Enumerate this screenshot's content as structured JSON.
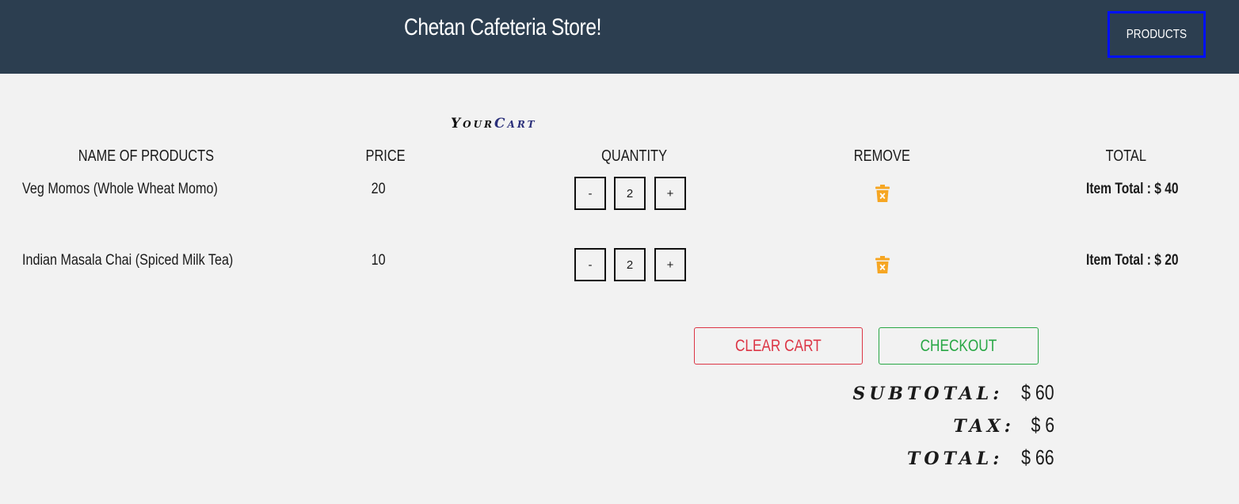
{
  "header": {
    "title": "Chetan Cafeteria Store!",
    "products_label": "PRODUCTS"
  },
  "cart": {
    "heading_word1": "Your",
    "heading_word2": "Cart",
    "columns": [
      "NAME OF PRODUCTS",
      "PRICE",
      "QUANTITY",
      "REMOVE",
      "TOTAL"
    ],
    "items": [
      {
        "name": "Veg Momos (Whole Wheat Momo)",
        "price": "20",
        "decrement": "-",
        "quantity": "2",
        "increment": "+",
        "item_total": "Item Total : $ 40"
      },
      {
        "name": "Indian Masala Chai (Spiced Milk Tea)",
        "price": "10",
        "decrement": "-",
        "quantity": "2",
        "increment": "+",
        "item_total": "Item Total : $ 20"
      }
    ],
    "remove_icon": "trash-icon",
    "remove_icon_color": "#f6a623"
  },
  "actions": {
    "clear_label": "CLEAR CART",
    "checkout_label": "CHECKOUT"
  },
  "summary": {
    "subtotal_label": "Subtotal:",
    "subtotal_value": "$ 60",
    "tax_label": "Tax:",
    "tax_value": "$ 6",
    "total_label": "Total:",
    "total_value": "$ 66"
  },
  "colors": {
    "header_bg": "#2c3e50",
    "products_border": "#0010ff",
    "clear": "#dc3545",
    "checkout": "#28a745",
    "page_bg": "#f2f2f2"
  }
}
